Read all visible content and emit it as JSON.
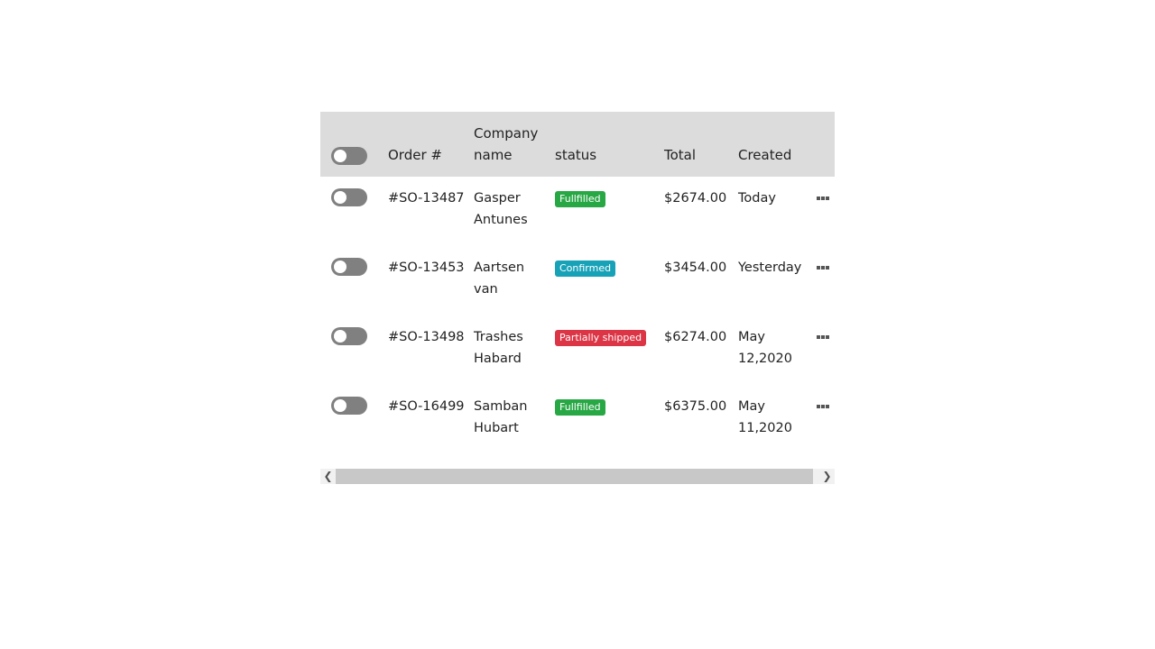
{
  "table": {
    "columns": {
      "order": "Order #",
      "company_line1": "Company",
      "company_line2": "name",
      "status": "status",
      "total": "Total",
      "created": "Created"
    },
    "rows": [
      {
        "order": "#SO-13487",
        "company_line1": "Gasper",
        "company_line2": "Antunes",
        "status": "Fullfilled",
        "status_color": "#28a745",
        "total": "$2674.00",
        "created_line1": "Today",
        "created_line2": ""
      },
      {
        "order": "#SO-13453",
        "company_line1": "Aartsen",
        "company_line2": "van",
        "status": "Confirmed",
        "status_color": "#17a2b8",
        "total": "$3454.00",
        "created_line1": "Yesterday",
        "created_line2": ""
      },
      {
        "order": "#SO-13498",
        "company_line1": "Trashes",
        "company_line2": "Habard",
        "status": "Partially shipped",
        "status_color": "#dc3545",
        "total": "$6274.00",
        "created_line1": "May",
        "created_line2": "12,2020"
      },
      {
        "order": "#SO-16499",
        "company_line1": "Samban",
        "company_line2": "Hubart",
        "status": "Fullfilled",
        "status_color": "#28a745",
        "total": "$6375.00",
        "created_line1": "May",
        "created_line2": "11,2020"
      }
    ],
    "icons": {
      "row_menu": "more-horizontal-icon",
      "scroll_left": "chevron-left-icon",
      "scroll_right": "chevron-right-icon"
    },
    "colors": {
      "header_bg": "#dcdcdc",
      "toggle_track": "#808080"
    }
  }
}
